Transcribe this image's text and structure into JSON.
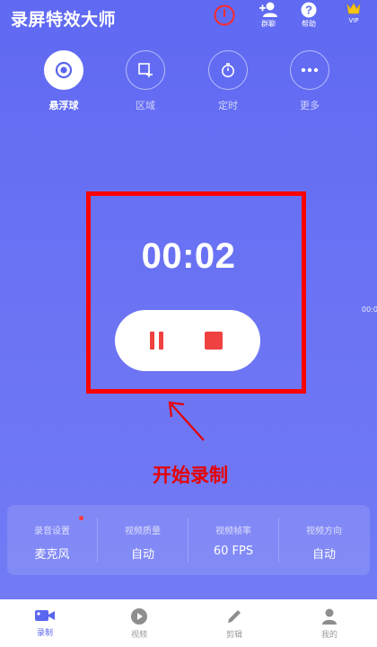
{
  "header": {
    "title": "录屏特效大师",
    "group_label": "群聊",
    "help_label": "帮助",
    "vip_label": "VIP"
  },
  "modes": [
    {
      "label": "悬浮球",
      "icon": "target-icon",
      "active": true
    },
    {
      "label": "区域",
      "icon": "region-icon",
      "active": false
    },
    {
      "label": "定时",
      "icon": "stopwatch-icon",
      "active": false
    },
    {
      "label": "更多",
      "icon": "more-icon",
      "active": false
    }
  ],
  "recording": {
    "timer": "00:02",
    "side_peek": "00:0"
  },
  "annotation": {
    "text": "开始录制"
  },
  "settings": [
    {
      "label": "录音设置",
      "value": "麦克风",
      "has_dot": true
    },
    {
      "label": "视频质量",
      "value": "自动",
      "has_dot": false
    },
    {
      "label": "视频帧率",
      "value": "60 FPS",
      "has_dot": false
    },
    {
      "label": "视频方向",
      "value": "自动",
      "has_dot": false
    }
  ],
  "bottom_nav": [
    {
      "label": "录制",
      "icon": "video-camera-icon",
      "active": true
    },
    {
      "label": "视频",
      "icon": "play-icon",
      "active": false
    },
    {
      "label": "剪辑",
      "icon": "pencil-icon",
      "active": false
    },
    {
      "label": "我的",
      "icon": "user-icon",
      "active": false
    }
  ],
  "colors": {
    "background_top": "#5f69f2",
    "accent": "#5b66ef",
    "record_red": "#f04141",
    "annotation_red": "#ff0000",
    "vip_gold": "#f5c518"
  }
}
